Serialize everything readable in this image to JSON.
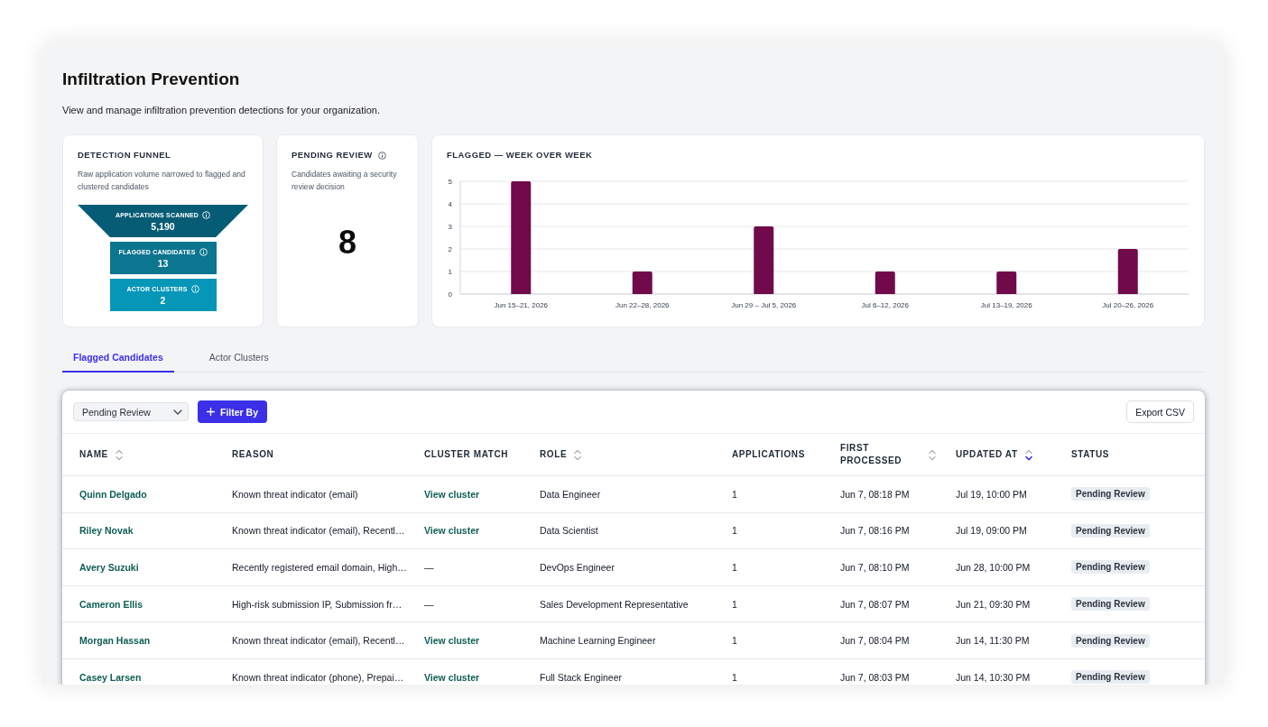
{
  "page": {
    "title": "Infiltration Prevention",
    "subtitle": "View and manage infiltration prevention detections for your organization."
  },
  "detection_funnel": {
    "title": "DETECTION FUNNEL",
    "description": "Raw application volume narrowed to flagged and clustered candidates",
    "stages": [
      {
        "kind": "trapezoid",
        "label": "APPLICATIONS SCANNED",
        "value": "5,190",
        "color": "#065c75"
      },
      {
        "kind": "bar",
        "label": "FLAGGED CANDIDATES",
        "value": "13",
        "color": "#0c7590"
      },
      {
        "kind": "bar",
        "label": "ACTOR CLUSTERS",
        "value": "2",
        "color": "#0696b8"
      }
    ]
  },
  "pending_review": {
    "title": "PENDING REVIEW",
    "description": "Candidates awaiting a security review decision",
    "value": "8"
  },
  "flagged_chart": {
    "title": "FLAGGED — WEEK OVER WEEK",
    "chart_data": {
      "type": "bar",
      "categories": [
        "Jun 15–21, 2026",
        "Jun 22–28, 2026",
        "Jun 29 – Jul 5, 2026",
        "Jul 6–12, 2026",
        "Jul 13–19, 2026",
        "Jul 20–26, 2026"
      ],
      "values": [
        5,
        1,
        3,
        1,
        1,
        2
      ],
      "ylim": [
        0,
        5
      ],
      "yticks": [
        0,
        1,
        2,
        3,
        4,
        5
      ],
      "grid": true
    }
  },
  "tabs": [
    {
      "label": "Flagged Candidates",
      "selected": true
    },
    {
      "label": "Actor Clusters",
      "selected": false
    }
  ],
  "toolbar": {
    "status_select": {
      "value": "Pending Review"
    },
    "filter_button": {
      "label": "Filter By"
    },
    "export_button": {
      "label": "Export CSV"
    }
  },
  "table": {
    "columns": [
      {
        "label": "NAME",
        "sortable": true,
        "sorted": false
      },
      {
        "label": "REASON",
        "sortable": false,
        "sorted": false
      },
      {
        "label": "CLUSTER MATCH",
        "sortable": false,
        "sorted": false
      },
      {
        "label": "ROLE",
        "sortable": true,
        "sorted": false
      },
      {
        "label": "APPLICATIONS",
        "sortable": false,
        "sorted": false
      },
      {
        "label": "FIRST PROCESSED",
        "sortable": true,
        "sorted": false
      },
      {
        "label": "UPDATED AT",
        "sortable": true,
        "sorted": true
      },
      {
        "label": "STATUS",
        "sortable": false,
        "sorted": false
      }
    ],
    "rows": [
      {
        "name": "Quinn Delgado",
        "reason": "Known threat indicator (email)",
        "cluster_match": {
          "kind": "link",
          "text": "View cluster"
        },
        "role": "Data Engineer",
        "applications": "1",
        "first_processed": "Jun 7, 08:18 PM",
        "updated_at": "Jul 19, 10:00 PM",
        "status": "Pending Review"
      },
      {
        "name": "Riley Novak",
        "reason": "Known threat indicator (email), Recentl…",
        "cluster_match": {
          "kind": "link",
          "text": "View cluster"
        },
        "role": "Data Scientist",
        "applications": "1",
        "first_processed": "Jun 7, 08:16 PM",
        "updated_at": "Jul 19, 09:00 PM",
        "status": "Pending Review"
      },
      {
        "name": "Avery Suzuki",
        "reason": "Recently registered email domain, High…",
        "cluster_match": {
          "kind": "none",
          "text": "—"
        },
        "role": "DevOps Engineer",
        "applications": "1",
        "first_processed": "Jun 7, 08:10 PM",
        "updated_at": "Jun 28, 10:00 PM",
        "status": "Pending Review"
      },
      {
        "name": "Cameron Ellis",
        "reason": "High-risk submission IP, Submission fr…",
        "cluster_match": {
          "kind": "none",
          "text": "—"
        },
        "role": "Sales Development Representative",
        "applications": "1",
        "first_processed": "Jun 7, 08:07 PM",
        "updated_at": "Jun 21, 09:30 PM",
        "status": "Pending Review"
      },
      {
        "name": "Morgan Hassan",
        "reason": "Known threat indicator (email), Recentl…",
        "cluster_match": {
          "kind": "link",
          "text": "View cluster"
        },
        "role": "Machine Learning Engineer",
        "applications": "1",
        "first_processed": "Jun 7, 08:04 PM",
        "updated_at": "Jun 14, 11:30 PM",
        "status": "Pending Review"
      },
      {
        "name": "Casey Larsen",
        "reason": "Known threat indicator (phone), Prepai…",
        "cluster_match": {
          "kind": "link",
          "text": "View cluster"
        },
        "role": "Full Stack Engineer",
        "applications": "1",
        "first_processed": "Jun 7, 08:03 PM",
        "updated_at": "Jun 14, 10:30 PM",
        "status": "Pending Review"
      }
    ]
  }
}
